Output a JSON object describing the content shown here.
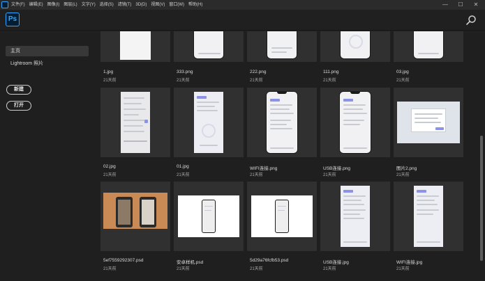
{
  "menu": {
    "items": [
      "文件(F)",
      "编辑(E)",
      "图像(I)",
      "图层(L)",
      "文字(Y)",
      "选择(S)",
      "滤镜(T)",
      "3D(D)",
      "视图(V)",
      "窗口(W)",
      "帮助(H)"
    ]
  },
  "window": {
    "minimize": "—",
    "maximize": "☐",
    "close": "✕"
  },
  "app": {
    "logo": "Ps"
  },
  "sidebar": {
    "home": "主页",
    "lightroom": "Lightroom 照片",
    "new_button": "新建",
    "open_button": "打开"
  },
  "files": [
    {
      "name": "1.jpg",
      "time": "21天前"
    },
    {
      "name": "333.png",
      "time": "21天前"
    },
    {
      "name": "222.png",
      "time": "21天前"
    },
    {
      "name": "111.png",
      "time": "21天前"
    },
    {
      "name": "03.jpg",
      "time": "21天前"
    },
    {
      "name": "02.jpg",
      "time": "21天前"
    },
    {
      "name": "01.jpg",
      "time": "21天前"
    },
    {
      "name": "WIFI连接.png",
      "time": "21天前"
    },
    {
      "name": "USB连接.png",
      "time": "21天前"
    },
    {
      "name": "图片2.png",
      "time": "21天前"
    },
    {
      "name": "5ef7559292307.psd",
      "time": "21天前"
    },
    {
      "name": "安卓样机.psd",
      "time": "21天前"
    },
    {
      "name": "5d29a76fcfb53.psd",
      "time": "21天前"
    },
    {
      "name": "USB连接.jpg",
      "time": "21天前"
    },
    {
      "name": "WIFI连接.jpg",
      "time": "21天前"
    }
  ],
  "colors": {
    "ps_blue": "#31a8ff",
    "background": "#1f1f1f",
    "thumb_bg": "#303030"
  },
  "icons": {
    "search": "search-icon",
    "app": "photoshop-logo"
  }
}
